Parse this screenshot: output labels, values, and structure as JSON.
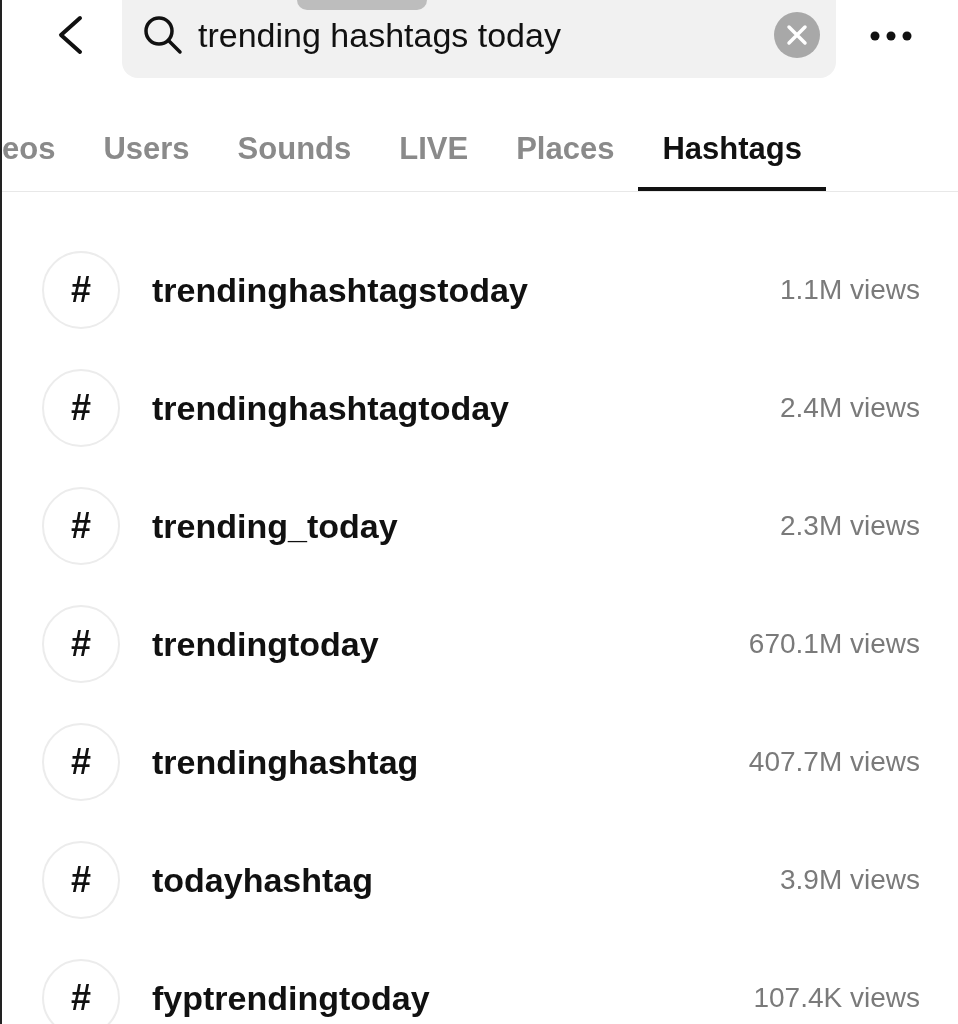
{
  "search": {
    "value": "trending hashtags today"
  },
  "tabs": [
    {
      "label": "eos",
      "selected": false
    },
    {
      "label": "Users",
      "selected": false
    },
    {
      "label": "Sounds",
      "selected": false
    },
    {
      "label": "LIVE",
      "selected": false
    },
    {
      "label": "Places",
      "selected": false
    },
    {
      "label": "Hashtags",
      "selected": true
    }
  ],
  "hashtags": [
    {
      "icon": "#",
      "name": "trendinghashtagstoday",
      "views": "1.1M views"
    },
    {
      "icon": "#",
      "name": "trendinghashtagtoday",
      "views": "2.4M views"
    },
    {
      "icon": "#",
      "name": "trending_today",
      "views": "2.3M views"
    },
    {
      "icon": "#",
      "name": "trendingtoday",
      "views": "670.1M views"
    },
    {
      "icon": "#",
      "name": "trendinghashtag",
      "views": "407.7M views"
    },
    {
      "icon": "#",
      "name": "todayhashtag",
      "views": "3.9M views"
    },
    {
      "icon": "#",
      "name": "fyptrendingtoday",
      "views": "107.4K views"
    }
  ]
}
